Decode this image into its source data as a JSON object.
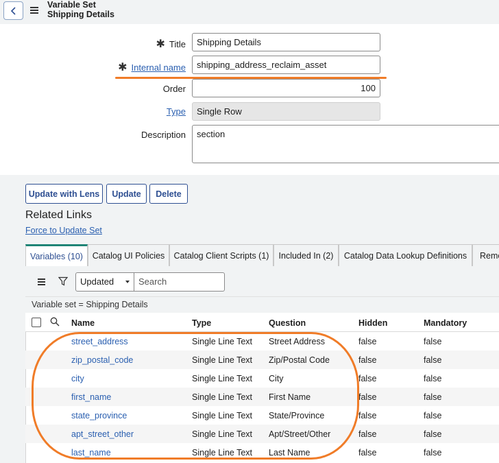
{
  "header": {
    "title_line1": "Variable Set",
    "title_line2": "Shipping Details"
  },
  "form": {
    "title_label": "Title",
    "title_value": "Shipping Details",
    "internal_name_label": "Internal name",
    "internal_name_value": "shipping_address_reclaim_asset",
    "order_label": "Order",
    "order_value": "100",
    "type_label": "Type",
    "type_value": "Single Row",
    "description_label": "Description",
    "description_value": "section",
    "required_marker": "✱"
  },
  "actions": {
    "update_with_lens": "Update with Lens",
    "update": "Update",
    "delete": "Delete"
  },
  "related_links": {
    "title": "Related Links",
    "force_update": "Force to Update Set"
  },
  "tabs": [
    {
      "label": "Variables (10)"
    },
    {
      "label": "Catalog UI Policies"
    },
    {
      "label": "Catalog Client Scripts (1)"
    },
    {
      "label": "Included In (2)"
    },
    {
      "label": "Catalog Data Lookup Definitions"
    },
    {
      "label": "Remo"
    }
  ],
  "list": {
    "sort_field": "Updated",
    "search_placeholder": "Search",
    "breadcrumb": "Variable set = Shipping Details",
    "columns": [
      "Name",
      "Type",
      "Question",
      "Hidden",
      "Mandatory"
    ],
    "rows": [
      {
        "name": "street_address",
        "type": "Single Line Text",
        "question": "Street Address",
        "hidden": "false",
        "mandatory": "false"
      },
      {
        "name": "zip_postal_code",
        "type": "Single Line Text",
        "question": "Zip/Postal Code",
        "hidden": "false",
        "mandatory": "false"
      },
      {
        "name": "city",
        "type": "Single Line Text",
        "question": "City",
        "hidden": "false",
        "mandatory": "false"
      },
      {
        "name": "first_name",
        "type": "Single Line Text",
        "question": "First Name",
        "hidden": "false",
        "mandatory": "false"
      },
      {
        "name": "state_province",
        "type": "Single Line Text",
        "question": "State/Province",
        "hidden": "false",
        "mandatory": "false"
      },
      {
        "name": "apt_street_other",
        "type": "Single Line Text",
        "question": "Apt/Street/Other",
        "hidden": "false",
        "mandatory": "false"
      },
      {
        "name": "last_name",
        "type": "Single Line Text",
        "question": "Last Name",
        "hidden": "false",
        "mandatory": "false"
      }
    ]
  },
  "colors": {
    "annotation": "#f07c28",
    "link": "#2a5fb0",
    "active_tab_accent": "#1f8476",
    "button_border": "#2e4f92"
  }
}
